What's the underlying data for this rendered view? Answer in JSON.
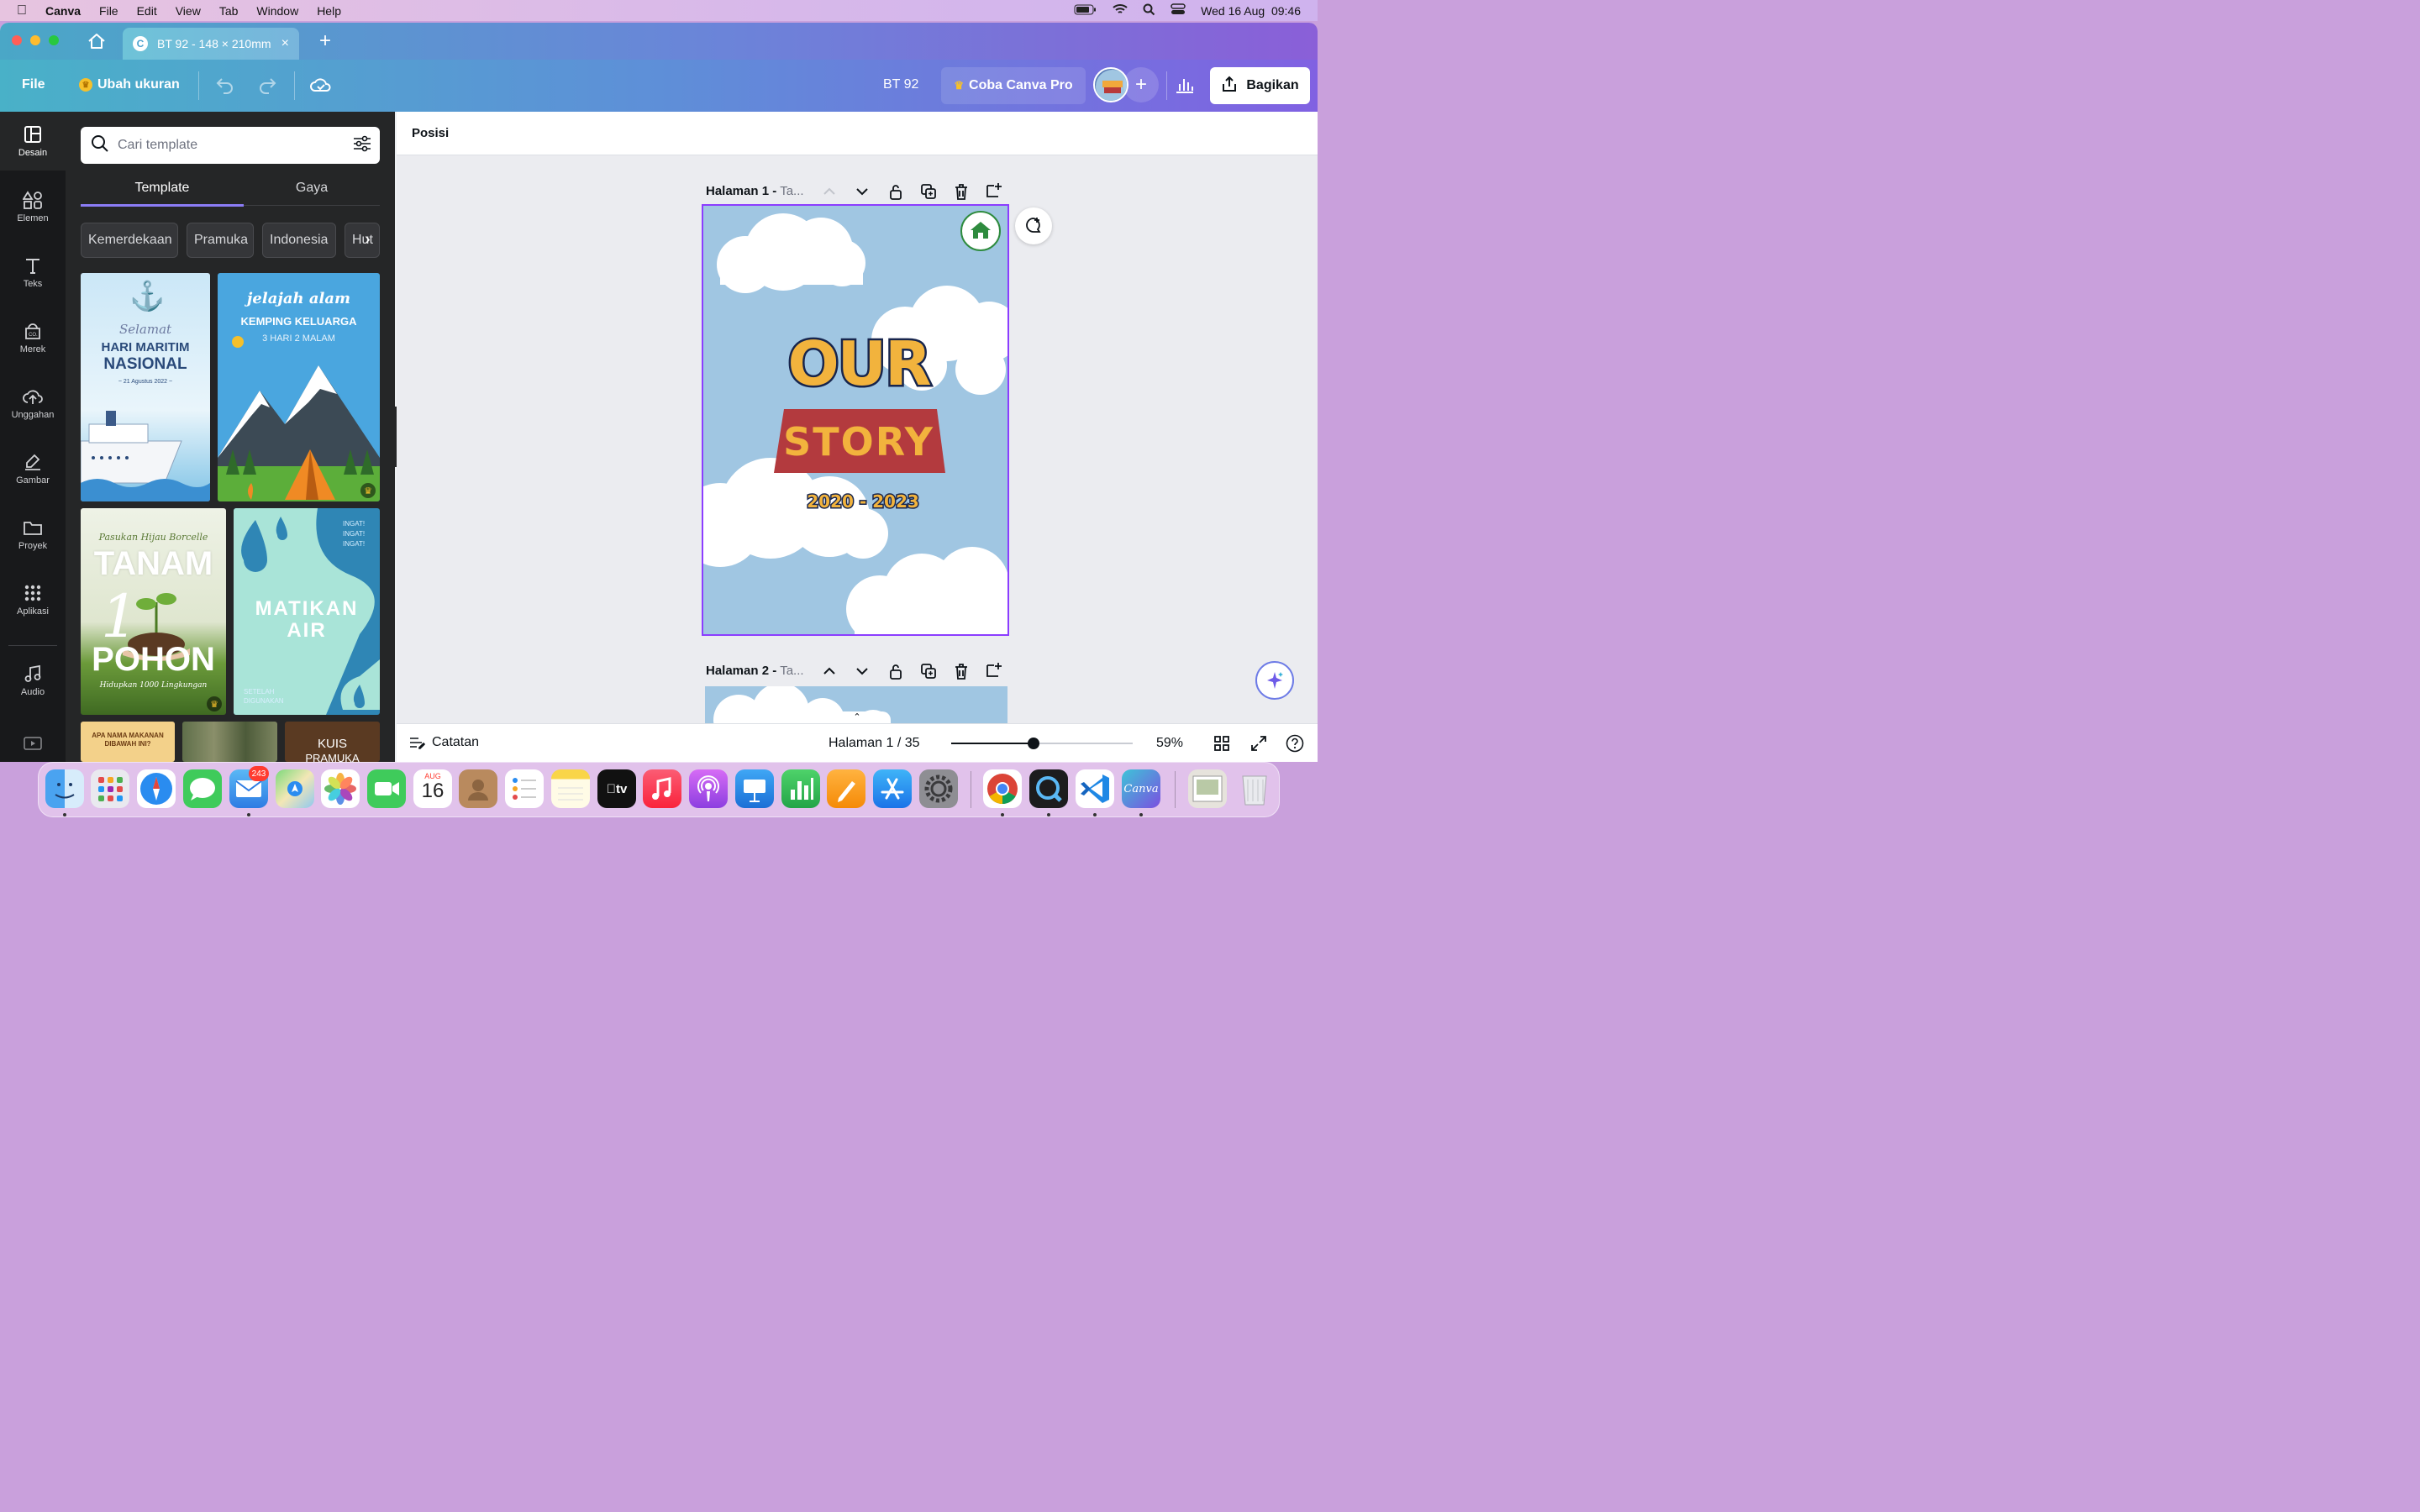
{
  "menubar": {
    "app_name": "Canva",
    "items": [
      "File",
      "Edit",
      "View",
      "Tab",
      "Window",
      "Help"
    ],
    "clock": "Wed 16 Aug  09:46"
  },
  "browser": {
    "tab_title": "BT 92 - 148 × 210mm"
  },
  "toolbar": {
    "file_label": "File",
    "resize_label": "Ubah ukuran",
    "doc_title": "BT 92",
    "pro_label": "Coba Canva Pro",
    "share_label": "Bagikan"
  },
  "rail": {
    "items": [
      {
        "label": "Desain",
        "icon": "layout-icon"
      },
      {
        "label": "Elemen",
        "icon": "shapes-icon"
      },
      {
        "label": "Teks",
        "icon": "text-icon"
      },
      {
        "label": "Merek",
        "icon": "brand-icon"
      },
      {
        "label": "Unggahan",
        "icon": "upload-icon"
      },
      {
        "label": "Gambar",
        "icon": "draw-icon"
      },
      {
        "label": "Proyek",
        "icon": "folder-icon"
      },
      {
        "label": "Aplikasi",
        "icon": "apps-icon"
      },
      {
        "label": "Audio",
        "icon": "audio-icon"
      }
    ]
  },
  "panel": {
    "search_placeholder": "Cari template",
    "tabs": [
      "Template",
      "Gaya"
    ],
    "chips": [
      "Kemerdekaan",
      "Pramuka",
      "Indonesia",
      "Hut"
    ],
    "templates": {
      "t1": {
        "line1": "Selamat",
        "line2": "HARI MARITIM",
        "line3": "NASIONAL",
        "line4": "~ 21 Agustus 2022 ~"
      },
      "t2": {
        "line1": "jelajah alam",
        "line2": "KEMPING KELUARGA",
        "line3": "3 HARI 2 MALAM"
      },
      "t3": {
        "line1": "Pasukan Hijau Borcelle",
        "line2": "TANAM",
        "line3": "1",
        "line4": "POHON",
        "line5": "Hidupkan 1000 Lingkungan"
      },
      "t4": {
        "line1": "INGAT!",
        "line2": "INGAT!",
        "line3": "INGAT!",
        "line4": "MATIKAN",
        "line5": "AIR",
        "line6": "SETELAH",
        "line7": "DIGUNAKAN"
      },
      "t5": {
        "line1": "APA NAMA MAKANAN",
        "line2": "DIBAWAH INI?"
      },
      "t7": {
        "line1": "KUIS",
        "line2": "PRAMUKA"
      }
    }
  },
  "editor": {
    "context_label": "Posisi",
    "page1_label": "Halaman 1 - ",
    "page1_title": "Ta...",
    "page2_label": "Halaman 2 - ",
    "page2_title": "Ta...",
    "design": {
      "line1": "OUR",
      "line2": "STORY",
      "years": "2020 - 2023"
    },
    "notes_label": "Catatan",
    "page_counter": "Halaman 1 / 35",
    "zoom": "59%",
    "zoom_level_fraction": 0.59
  },
  "dock": {
    "mail_badge": "243",
    "calendar_month": "AUG",
    "calendar_day": "16",
    "apps": [
      "finder-icon",
      "launchpad-icon",
      "safari-icon",
      "messages-icon",
      "mail-icon",
      "maps-icon",
      "photos-icon",
      "facetime-icon",
      "calendar-icon",
      "contacts-icon",
      "reminders-icon",
      "notes-icon",
      "tv-icon",
      "music-icon",
      "podcasts-icon",
      "keynote-icon",
      "numbers-icon",
      "pages-icon",
      "appstore-icon",
      "settings-icon",
      "chrome-icon",
      "quicktime-icon",
      "vscode-icon",
      "canva-icon",
      "preview-icon",
      "trash-icon"
    ]
  }
}
